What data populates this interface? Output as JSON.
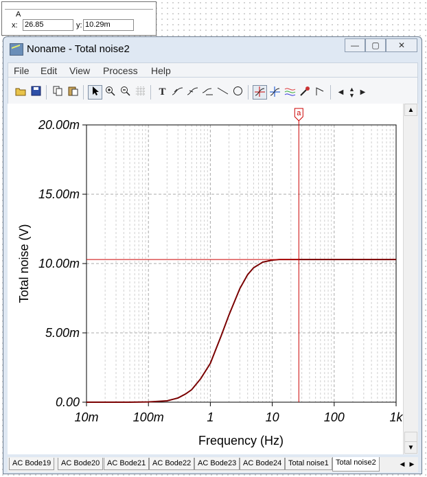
{
  "cursor": {
    "name": "A",
    "x_label": "x:",
    "x_value": "26.85",
    "y_label": "y:",
    "y_value": "10.29m"
  },
  "window": {
    "title": "Noname - Total noise2",
    "minimize": "—",
    "maximize": "▢",
    "close": "✕"
  },
  "menu": [
    "File",
    "Edit",
    "View",
    "Process",
    "Help"
  ],
  "toolbar": {
    "icons": [
      "open-folder-icon",
      "save-icon",
      "copy-icon",
      "paste-icon",
      "pointer-icon",
      "zoom-in-icon",
      "zoom-out-icon",
      "grid-icon",
      "text-icon",
      "curve-label-icon",
      "curve-label2-icon",
      "measure-icon",
      "line-icon",
      "circle-icon",
      "cursor-a-icon",
      "cursor-b-icon",
      "curves-icon",
      "marker-icon",
      "flag-icon",
      "left-arrow-icon",
      "up-down-arrow-icon",
      "right-arrow-icon"
    ]
  },
  "chart_data": {
    "type": "line",
    "xlabel": "Frequency (Hz)",
    "ylabel": "Total noise (V)",
    "x_scale": "log",
    "xlim": [
      0.01,
      1000
    ],
    "ylim": [
      0,
      0.02
    ],
    "x_ticks": [
      "10m",
      "100m",
      "1",
      "10",
      "100",
      "1k"
    ],
    "y_ticks": [
      "0.00",
      "5.00m",
      "10.00m",
      "15.00m",
      "20.00m"
    ],
    "grid": true,
    "series": [
      {
        "color": "#7a0000",
        "x": [
          0.01,
          0.05,
          0.1,
          0.2,
          0.3,
          0.4,
          0.5,
          0.7,
          1,
          1.5,
          2,
          3,
          4,
          5,
          7,
          10,
          13,
          20,
          50,
          100,
          1000
        ],
        "y": [
          0.0,
          0.0,
          2e-05,
          0.0001,
          0.0003,
          0.0006,
          0.0009,
          0.0017,
          0.0028,
          0.0048,
          0.0063,
          0.0082,
          0.0092,
          0.0097,
          0.0101,
          0.01025,
          0.01029,
          0.01029,
          0.01029,
          0.01029,
          0.01029
        ]
      }
    ],
    "cursor": {
      "label": "a",
      "x": 26.85,
      "y": 0.01029,
      "color": "#cc0000"
    }
  },
  "tabs": [
    "AC Bode19",
    "AC Bode20",
    "AC Bode21",
    "AC Bode22",
    "AC Bode23",
    "AC Bode24",
    "Total noise1",
    "Total noise2"
  ],
  "active_tab": "Total noise2"
}
